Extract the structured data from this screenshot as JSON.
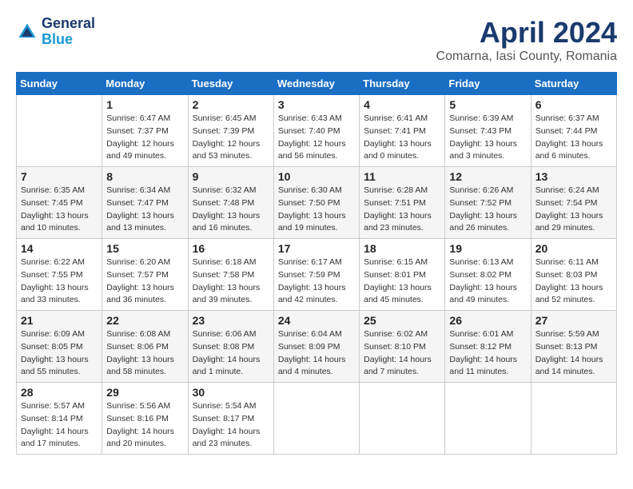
{
  "header": {
    "logo_line1": "General",
    "logo_line2": "Blue",
    "title": "April 2024",
    "subtitle": "Comarna, Iasi County, Romania"
  },
  "days_of_week": [
    "Sunday",
    "Monday",
    "Tuesday",
    "Wednesday",
    "Thursday",
    "Friday",
    "Saturday"
  ],
  "weeks": [
    [
      {
        "num": "",
        "info": ""
      },
      {
        "num": "1",
        "info": "Sunrise: 6:47 AM\nSunset: 7:37 PM\nDaylight: 12 hours\nand 49 minutes."
      },
      {
        "num": "2",
        "info": "Sunrise: 6:45 AM\nSunset: 7:39 PM\nDaylight: 12 hours\nand 53 minutes."
      },
      {
        "num": "3",
        "info": "Sunrise: 6:43 AM\nSunset: 7:40 PM\nDaylight: 12 hours\nand 56 minutes."
      },
      {
        "num": "4",
        "info": "Sunrise: 6:41 AM\nSunset: 7:41 PM\nDaylight: 13 hours\nand 0 minutes."
      },
      {
        "num": "5",
        "info": "Sunrise: 6:39 AM\nSunset: 7:43 PM\nDaylight: 13 hours\nand 3 minutes."
      },
      {
        "num": "6",
        "info": "Sunrise: 6:37 AM\nSunset: 7:44 PM\nDaylight: 13 hours\nand 6 minutes."
      }
    ],
    [
      {
        "num": "7",
        "info": "Sunrise: 6:35 AM\nSunset: 7:45 PM\nDaylight: 13 hours\nand 10 minutes."
      },
      {
        "num": "8",
        "info": "Sunrise: 6:34 AM\nSunset: 7:47 PM\nDaylight: 13 hours\nand 13 minutes."
      },
      {
        "num": "9",
        "info": "Sunrise: 6:32 AM\nSunset: 7:48 PM\nDaylight: 13 hours\nand 16 minutes."
      },
      {
        "num": "10",
        "info": "Sunrise: 6:30 AM\nSunset: 7:50 PM\nDaylight: 13 hours\nand 19 minutes."
      },
      {
        "num": "11",
        "info": "Sunrise: 6:28 AM\nSunset: 7:51 PM\nDaylight: 13 hours\nand 23 minutes."
      },
      {
        "num": "12",
        "info": "Sunrise: 6:26 AM\nSunset: 7:52 PM\nDaylight: 13 hours\nand 26 minutes."
      },
      {
        "num": "13",
        "info": "Sunrise: 6:24 AM\nSunset: 7:54 PM\nDaylight: 13 hours\nand 29 minutes."
      }
    ],
    [
      {
        "num": "14",
        "info": "Sunrise: 6:22 AM\nSunset: 7:55 PM\nDaylight: 13 hours\nand 33 minutes."
      },
      {
        "num": "15",
        "info": "Sunrise: 6:20 AM\nSunset: 7:57 PM\nDaylight: 13 hours\nand 36 minutes."
      },
      {
        "num": "16",
        "info": "Sunrise: 6:18 AM\nSunset: 7:58 PM\nDaylight: 13 hours\nand 39 minutes."
      },
      {
        "num": "17",
        "info": "Sunrise: 6:17 AM\nSunset: 7:59 PM\nDaylight: 13 hours\nand 42 minutes."
      },
      {
        "num": "18",
        "info": "Sunrise: 6:15 AM\nSunset: 8:01 PM\nDaylight: 13 hours\nand 45 minutes."
      },
      {
        "num": "19",
        "info": "Sunrise: 6:13 AM\nSunset: 8:02 PM\nDaylight: 13 hours\nand 49 minutes."
      },
      {
        "num": "20",
        "info": "Sunrise: 6:11 AM\nSunset: 8:03 PM\nDaylight: 13 hours\nand 52 minutes."
      }
    ],
    [
      {
        "num": "21",
        "info": "Sunrise: 6:09 AM\nSunset: 8:05 PM\nDaylight: 13 hours\nand 55 minutes."
      },
      {
        "num": "22",
        "info": "Sunrise: 6:08 AM\nSunset: 8:06 PM\nDaylight: 13 hours\nand 58 minutes."
      },
      {
        "num": "23",
        "info": "Sunrise: 6:06 AM\nSunset: 8:08 PM\nDaylight: 14 hours\nand 1 minute."
      },
      {
        "num": "24",
        "info": "Sunrise: 6:04 AM\nSunset: 8:09 PM\nDaylight: 14 hours\nand 4 minutes."
      },
      {
        "num": "25",
        "info": "Sunrise: 6:02 AM\nSunset: 8:10 PM\nDaylight: 14 hours\nand 7 minutes."
      },
      {
        "num": "26",
        "info": "Sunrise: 6:01 AM\nSunset: 8:12 PM\nDaylight: 14 hours\nand 11 minutes."
      },
      {
        "num": "27",
        "info": "Sunrise: 5:59 AM\nSunset: 8:13 PM\nDaylight: 14 hours\nand 14 minutes."
      }
    ],
    [
      {
        "num": "28",
        "info": "Sunrise: 5:57 AM\nSunset: 8:14 PM\nDaylight: 14 hours\nand 17 minutes."
      },
      {
        "num": "29",
        "info": "Sunrise: 5:56 AM\nSunset: 8:16 PM\nDaylight: 14 hours\nand 20 minutes."
      },
      {
        "num": "30",
        "info": "Sunrise: 5:54 AM\nSunset: 8:17 PM\nDaylight: 14 hours\nand 23 minutes."
      },
      {
        "num": "",
        "info": ""
      },
      {
        "num": "",
        "info": ""
      },
      {
        "num": "",
        "info": ""
      },
      {
        "num": "",
        "info": ""
      }
    ]
  ]
}
